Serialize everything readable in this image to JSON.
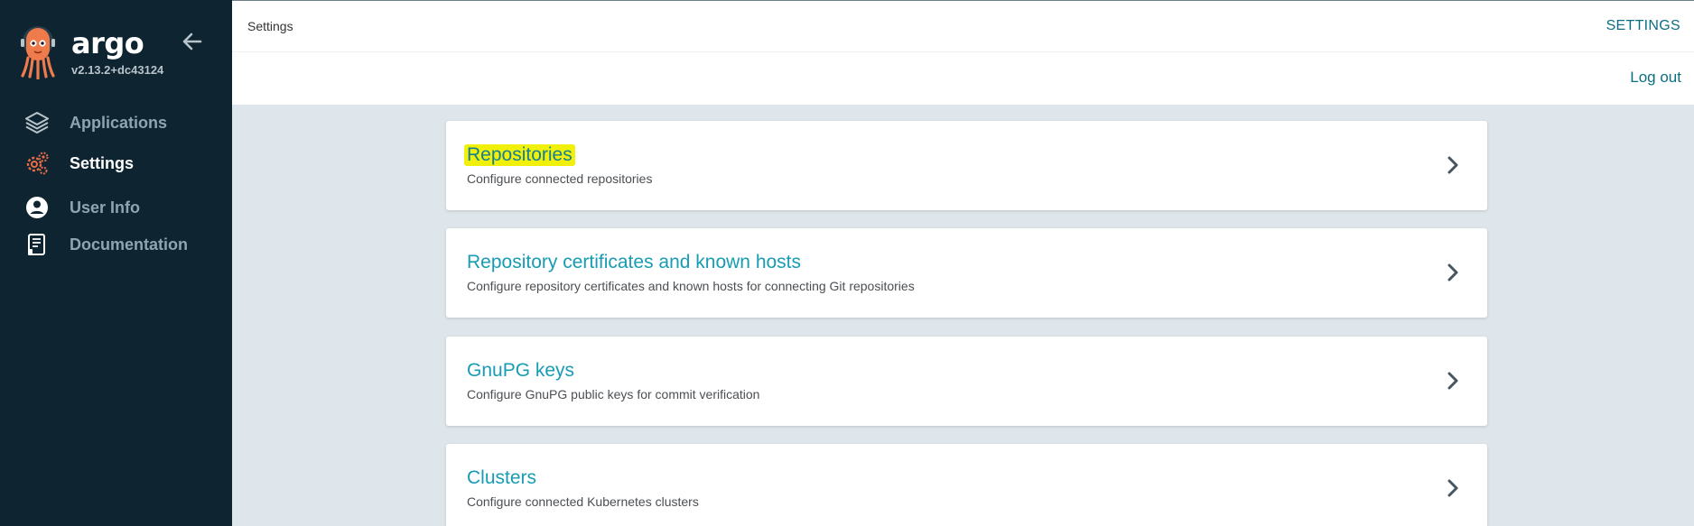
{
  "app": {
    "logo_text": "argo",
    "version": "v2.13.2+dc43124"
  },
  "sidebar": {
    "items": [
      {
        "label": "Applications",
        "icon": "layers-icon",
        "active": false
      },
      {
        "label": "Settings",
        "icon": "gears-icon",
        "active": true
      },
      {
        "label": "User Info",
        "icon": "user-circle-icon",
        "active": false
      },
      {
        "label": "Documentation",
        "icon": "book-icon",
        "active": false
      }
    ]
  },
  "header": {
    "breadcrumb": "Settings",
    "page_title": "SETTINGS",
    "logout_label": "Log out"
  },
  "settings_cards": [
    {
      "title": "Repositories",
      "description": "Configure connected repositories",
      "highlighted": true
    },
    {
      "title": "Repository certificates and known hosts",
      "description": "Configure repository certificates and known hosts for connecting Git repositories",
      "highlighted": false
    },
    {
      "title": "GnuPG keys",
      "description": "Configure GnuPG public keys for commit verification",
      "highlighted": false
    },
    {
      "title": "Clusters",
      "description": "Configure connected Kubernetes clusters",
      "highlighted": false
    }
  ],
  "colors": {
    "sidebar_bg": "#0e2431",
    "accent": "#179cb4",
    "highlight": "#f1f00a",
    "settings_icon": "#e96d46"
  }
}
